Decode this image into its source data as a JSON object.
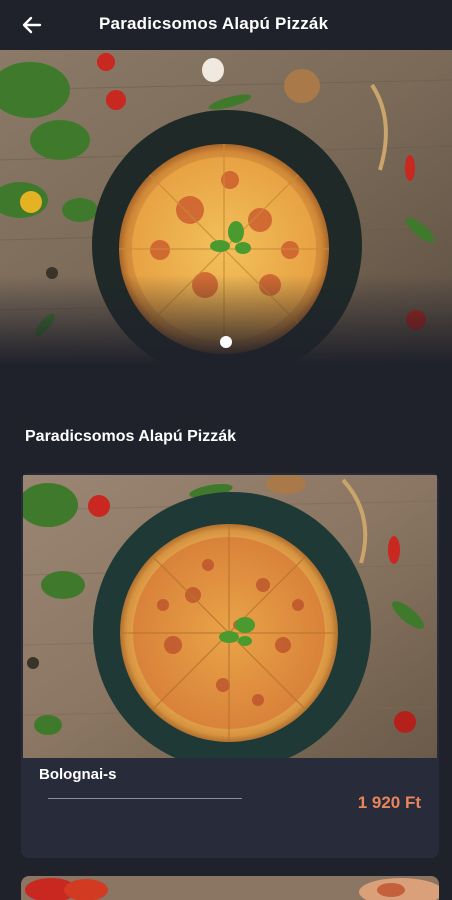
{
  "header": {
    "title": "Paradicsomos Alapú Pizzák",
    "back_icon": "arrow-left-icon"
  },
  "hero": {
    "image": "pizza-on-slate-board",
    "carousel_pages": 1,
    "active_page": 1
  },
  "section": {
    "title": "Paradicsomos Alapú Pizzák"
  },
  "products": [
    {
      "name": "Bolognai-s",
      "price": "1 920 Ft",
      "image": "bolognese-pizza"
    }
  ],
  "colors": {
    "background": "#1f212b",
    "card": "#282b39",
    "price": "#e8855a"
  }
}
